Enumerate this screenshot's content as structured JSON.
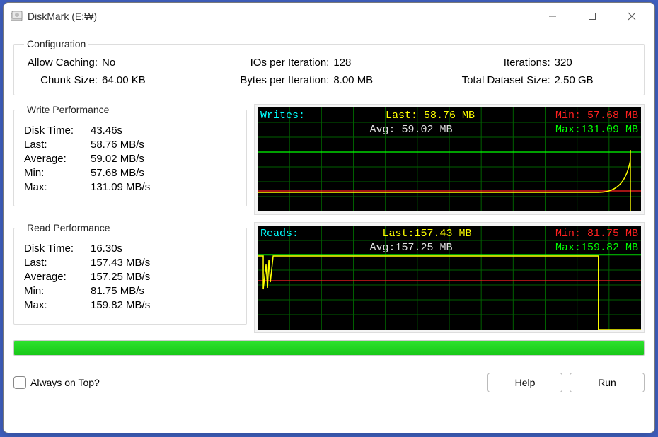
{
  "title": "DiskMark (E:₩)",
  "config": {
    "legend": "Configuration",
    "allowCachingLabel": "Allow Caching:",
    "allowCaching": "No",
    "iosPerIterationLabel": "IOs per Iteration:",
    "iosPerIteration": "128",
    "iterationsLabel": "Iterations:",
    "iterations": "320",
    "chunkSizeLabel": "Chunk Size:",
    "chunkSize": "64.00 KB",
    "bytesPerIterationLabel": "Bytes per Iteration:",
    "bytesPerIteration": "8.00 MB",
    "totalDatasetLabel": "Total Dataset Size:",
    "totalDataset": "2.50 GB"
  },
  "write": {
    "legend": "Write Performance",
    "diskTimeLabel": "Disk Time:",
    "diskTime": "43.46s",
    "lastLabel": "Last:",
    "last": "58.76 MB/s",
    "avgLabel": "Average:",
    "avg": "59.02 MB/s",
    "minLabel": "Min:",
    "min": "57.68 MB/s",
    "maxLabel": "Max:",
    "max": "131.09 MB/s",
    "chart": {
      "title": "Writes:",
      "lastLabel": "Last:",
      "lastVal": " 58.76 MB",
      "avgLabel": "Avg:",
      "avgVal": " 59.02 MB",
      "minLabel": "Min:",
      "minVal": " 57.68 MB",
      "maxLabel": "Max:",
      "maxVal": "131.09 MB"
    }
  },
  "read": {
    "legend": "Read Performance",
    "diskTimeLabel": "Disk Time:",
    "diskTime": "16.30s",
    "lastLabel": "Last:",
    "last": "157.43 MB/s",
    "avgLabel": "Average:",
    "avg": "157.25 MB/s",
    "minLabel": "Min:",
    "min": "81.75 MB/s",
    "maxLabel": "Max:",
    "max": "159.82 MB/s",
    "chart": {
      "title": "Reads:",
      "lastLabel": "Last:",
      "lastVal": "157.43 MB",
      "avgLabel": "Avg:",
      "avgVal": "157.25 MB",
      "minLabel": "Min:",
      "minVal": " 81.75 MB",
      "maxLabel": "Max:",
      "maxVal": "159.82 MB"
    }
  },
  "bottom": {
    "alwaysOnTop": "Always on Top?",
    "help": "Help",
    "run": "Run"
  },
  "chart_data": [
    {
      "type": "line",
      "title": "Writes",
      "ylabel": "MB/s",
      "ylim": [
        0,
        140
      ],
      "series": [
        {
          "name": "last",
          "color": "#ffff00",
          "endpoints": [
            58.76,
            131.09
          ]
        },
        {
          "name": "min",
          "color": "#ff2020",
          "constant": 57.68
        },
        {
          "name": "max",
          "color": "#00ff00",
          "constant": 131.09
        },
        {
          "name": "avg",
          "color": "#e0e0e0",
          "constant": 59.02
        }
      ]
    },
    {
      "type": "line",
      "title": "Reads",
      "ylabel": "MB/s",
      "ylim": [
        0,
        170
      ],
      "series": [
        {
          "name": "last",
          "color": "#ffff00",
          "dip_at_start_to": 81.75,
          "endpoints": [
            157.43,
            157.43
          ]
        },
        {
          "name": "min",
          "color": "#ff2020",
          "constant": 81.75
        },
        {
          "name": "max",
          "color": "#00ff00",
          "constant": 159.82
        },
        {
          "name": "avg",
          "color": "#e0e0e0",
          "constant": 157.25
        }
      ]
    }
  ]
}
